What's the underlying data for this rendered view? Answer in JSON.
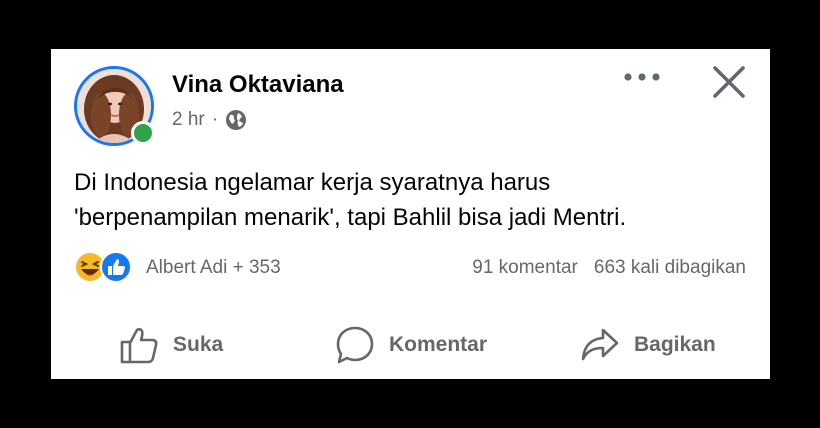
{
  "post": {
    "author": "Vina Oktaviana",
    "time": "2 hr",
    "separator": "·",
    "text_lines": [
      "Di Indonesia ngelamar kerja syaratnya harus",
      "'berpenampilan menarik', tapi Bahlil bisa jadi Mentri."
    ]
  },
  "reactions": {
    "reactors": "Albert Adi + 353",
    "comments": "91 komentar",
    "shares": "663 kali dibagikan",
    "icons": [
      "haha-reaction-icon",
      "like-reaction-icon"
    ]
  },
  "actions": {
    "like": "Suka",
    "comment": "Komentar",
    "share": "Bagikan"
  },
  "colors": {
    "accent": "#1877f2",
    "online": "#31a24c",
    "muted": "#65676b",
    "haha": "#f7b928"
  }
}
